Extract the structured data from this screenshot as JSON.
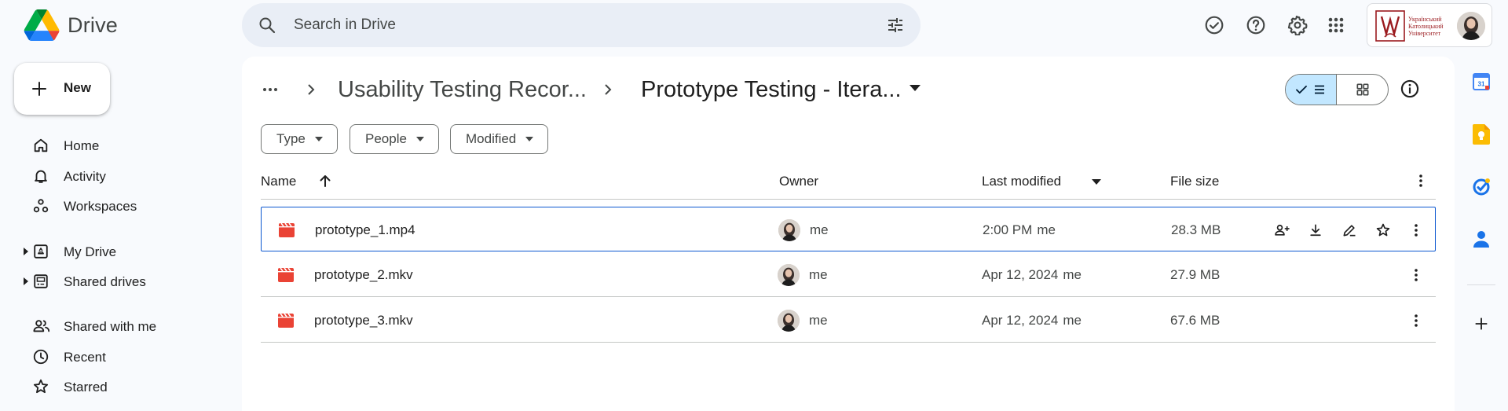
{
  "app": {
    "name": "Drive"
  },
  "search": {
    "placeholder": "Search in Drive"
  },
  "header_icons": [
    "ready-for-offline-icon",
    "help-icon",
    "settings-icon",
    "apps-grid-icon"
  ],
  "account": {
    "org_name_lines": [
      "Український",
      "Католицький",
      "Університет"
    ]
  },
  "sidebar": {
    "new_label": "New",
    "items": [
      {
        "label": "Home",
        "icon": "home-icon"
      },
      {
        "label": "Activity",
        "icon": "bell-icon"
      },
      {
        "label": "Workspaces",
        "icon": "workspaces-icon"
      },
      {
        "label": "My Drive",
        "icon": "my-drive-icon"
      },
      {
        "label": "Shared drives",
        "icon": "shared-drives-icon"
      },
      {
        "label": "Shared with me",
        "icon": "people-icon"
      },
      {
        "label": "Recent",
        "icon": "clock-icon"
      },
      {
        "label": "Starred",
        "icon": "star-icon"
      }
    ]
  },
  "breadcrumb": {
    "parent": "Usability Testing Recor...",
    "current": "Prototype Testing - Itera..."
  },
  "filters": [
    {
      "label": "Type"
    },
    {
      "label": "People"
    },
    {
      "label": "Modified"
    }
  ],
  "table": {
    "headers": {
      "name": "Name",
      "owner": "Owner",
      "modified": "Last modified",
      "size": "File size"
    },
    "rows": [
      {
        "name": "prototype_1.mp4",
        "owner": "me",
        "modified": "2:00 PM",
        "modified_by": "me",
        "size": "28.3 MB",
        "selected": true
      },
      {
        "name": "prototype_2.mkv",
        "owner": "me",
        "modified": "Apr 12, 2024",
        "modified_by": "me",
        "size": "27.9 MB",
        "selected": false
      },
      {
        "name": "prototype_3.mkv",
        "owner": "me",
        "modified": "Apr 12, 2024",
        "modified_by": "me",
        "size": "67.6 MB",
        "selected": false
      }
    ]
  },
  "side_panel": {
    "calendar_day": "31",
    "apps": [
      "calendar-icon",
      "keep-icon",
      "tasks-icon",
      "contacts-icon",
      "add-icon"
    ]
  },
  "colors": {
    "accent": "#0b57d0",
    "selected_toggle": "#c2e7ff",
    "video_red": "#ea4335",
    "bg": "#f8fafd"
  }
}
